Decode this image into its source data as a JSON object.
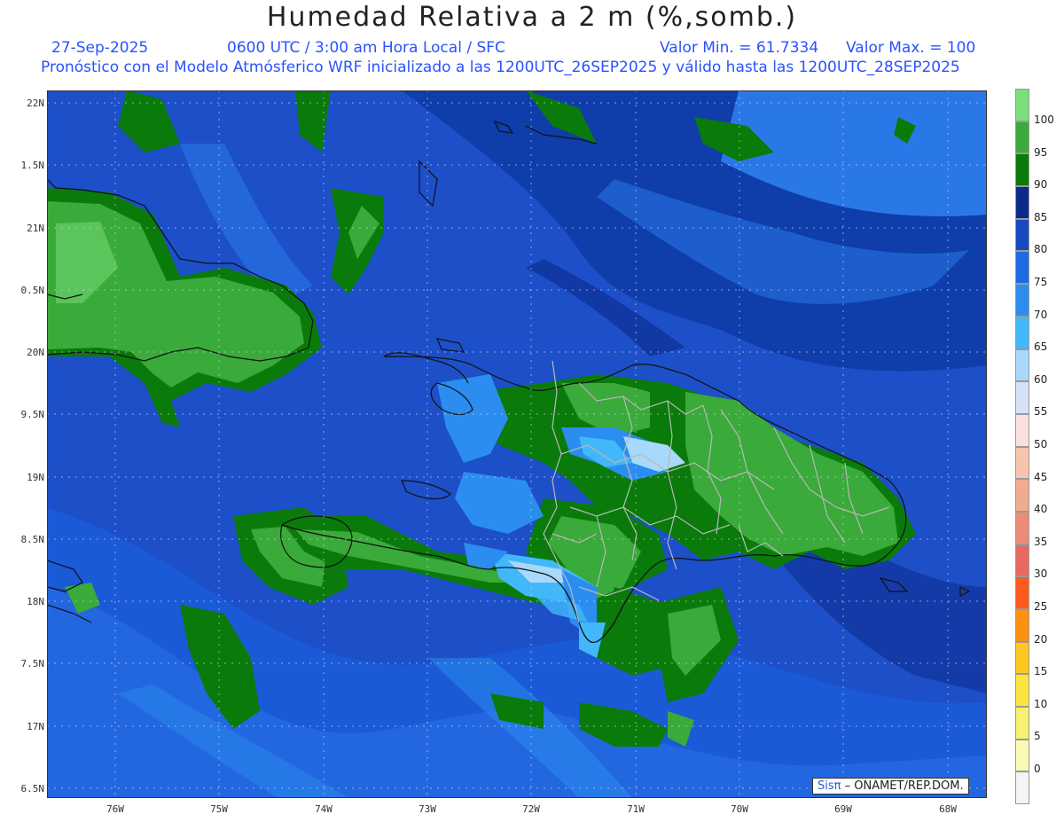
{
  "header": {
    "title": "Humedad Relativa a 2 m (%,somb.)",
    "date": "27-Sep-2025",
    "time_info": "0600 UTC / 3:00 am Hora Local / SFC",
    "min_value": "Valor Min. = 61.7334",
    "max_value": "Valor Max. = 100",
    "forecast_info": "Pronóstico con el Modelo Atmósferico WRF inicializado a las 1200UTC_26SEP2025 y válido hasta las  1200UTC_28SEP2025"
  },
  "map": {
    "lat_labels": [
      "22N",
      "1.5N",
      "21N",
      "0.5N",
      "20N",
      "9.5N",
      "19N",
      "8.5N",
      "18N",
      "7.5N",
      "17N",
      "6.5N"
    ],
    "lon_labels": [
      "76W",
      "75W",
      "74W",
      "73W",
      "72W",
      "71W",
      "70W",
      "69W",
      "68W"
    ]
  },
  "colorbar": {
    "labels": [
      "100",
      "95",
      "90",
      "85",
      "80",
      "75",
      "70",
      "65",
      "60",
      "55",
      "50",
      "45",
      "40",
      "35",
      "30",
      "25",
      "20",
      "15",
      "10",
      "5",
      "0"
    ],
    "colors": [
      "#7be07b",
      "#3aaa3a",
      "#0a7a0a",
      "#0c2a8a",
      "#1848c0",
      "#1e6ae6",
      "#2b8df0",
      "#42b8fa",
      "#a8d8fa",
      "#d6e2f8",
      "#fbe0e0",
      "#f7c4ae",
      "#f1ab90",
      "#ec8c78",
      "#e66a62",
      "#ff5a1e",
      "#ff9010",
      "#ffc820",
      "#fbe640",
      "#f8f070",
      "#f9fbb4",
      "#f4f4f4"
    ]
  },
  "credit": {
    "brand": "Sisπ",
    "text": "– ONAMET/REP.DOM."
  }
}
